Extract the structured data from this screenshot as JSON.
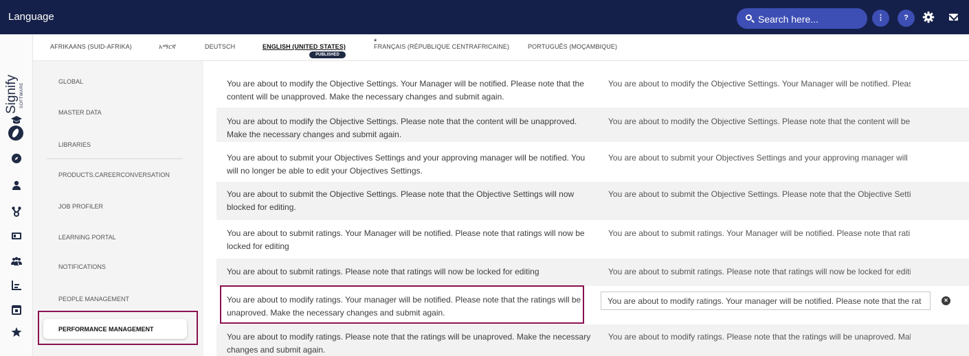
{
  "header": {
    "title": "Language",
    "search_placeholder": "Search here...",
    "more_label": "⋮",
    "help_label": "?",
    "icons": [
      "search-icon",
      "more-icon",
      "help-icon",
      "gear-icon",
      "mail-icon"
    ],
    "bg_color": "#15204a",
    "accent_color": "#3d4eb4"
  },
  "logo": {
    "name": "Signify",
    "sub": "SOFTWARE"
  },
  "rail_icons": [
    "graduation-cap-icon",
    "compass-icon",
    "person-icon",
    "hierarchy-icon",
    "id-card-icon",
    "people-icon",
    "chart-icon",
    "calendar-icon",
    "star-icon"
  ],
  "tabs": [
    {
      "label": "AFRIKAANS (SUID-AFRIKA)"
    },
    {
      "label": "አማርኛ"
    },
    {
      "label": "DEUTSCH"
    },
    {
      "label": "ENGLISH (UNITED STATES)",
      "active": true,
      "badge": "PUBLISHED",
      "marker": "*"
    },
    {
      "label": "FRANÇAIS (RÉPUBLIQUE CENTRAFRICAINE)"
    },
    {
      "label": "PORTUGUÊS (MOÇAMBIQUE)"
    }
  ],
  "categories": [
    {
      "label": "GLOBAL"
    },
    {
      "label": "MASTER DATA"
    },
    {
      "label": "LIBRARIES"
    },
    {
      "label": "PRODUCTS.CAREERCONVERSATION"
    },
    {
      "label": "JOB PROFILER"
    },
    {
      "label": "LEARNING PORTAL"
    },
    {
      "label": "NOTIFICATIONS"
    },
    {
      "label": "PEOPLE MANAGEMENT"
    },
    {
      "label": "PERFORMANCE MANAGEMENT",
      "active": true
    }
  ],
  "highlight_color": "#8a1050",
  "rows": [
    {
      "source": "You are about to modify the Objective Settings. Your Manager will be notified. Please note that the content will be unapproved. Make the necessary changes and submit again.",
      "target": "You are about to modify the Objective Settings. Your Manager will be notified. Please r"
    },
    {
      "source": "You are about to modify the Objective Settings. Please note that the content will be unapproved. Make the necessary changes and submit again.",
      "target": "You are about to modify the Objective Settings. Please note that the content will be un"
    },
    {
      "source": "You are about to submit your Objectives Settings and your approving manager will be notified. You will no longer be able to edit your Objectives Settings.",
      "target": "You are about to submit your Objectives Settings and your approving manager will be ı"
    },
    {
      "source": "You are about to submit the Objective Settings. Please note that the Objective Settings will now blocked for editing.",
      "target": "You are about to submit the Objective Settings. Please note that the Objective Settings"
    },
    {
      "source": "You are about to submit ratings. Your Manager will be notified. Please note that ratings will now be locked for editing",
      "target": "You are about to submit ratings. Your Manager will be notified. Please note that ratings"
    },
    {
      "source": "You are about to submit ratings. Please note that ratings will now be locked for editing",
      "target": "You are about to submit ratings. Please note that ratings will now be locked for editing"
    },
    {
      "source": "You are about to modify ratings. Your manager will be notified. Please note that the ratings will be unaproved. Make the necessary changes and submit again.",
      "target": "You are about to modify ratings. Your manager will be notified. Please note that the rat",
      "editing": true,
      "clear_label": "×"
    },
    {
      "source": "You are about to modify ratings. Please note that the ratings will be unaproved. Make the necessary changes and submit again.",
      "target": "You are about to modify ratings. Please note that the ratings will be unaproved. Make t"
    }
  ]
}
